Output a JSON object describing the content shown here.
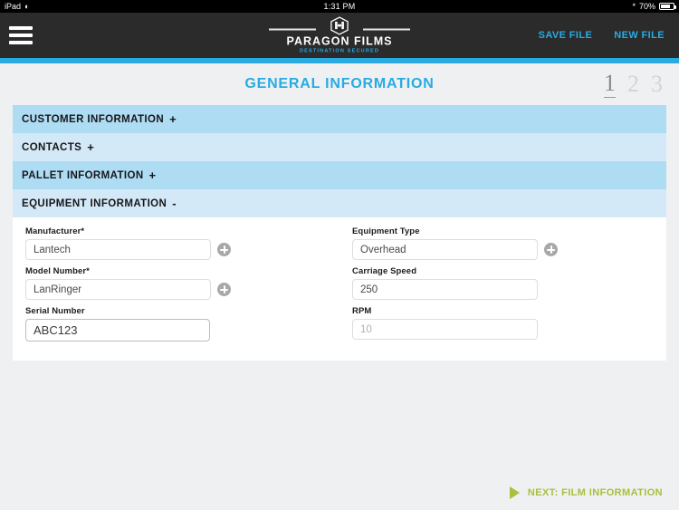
{
  "status_bar": {
    "device": "iPad",
    "wifi_icon": "wifi-icon",
    "time": "1:31 PM",
    "bluetooth_icon": "bluetooth-icon",
    "battery_percent": "70%"
  },
  "header": {
    "menu_icon": "hamburger-menu-icon",
    "brand_name": "PARAGON FILMS",
    "brand_tagline": "DESTINATION SECURED",
    "brand_emblem_icon": "paragon-shield-icon",
    "save_file_label": "SAVE FILE",
    "new_file_label": "NEW FILE",
    "link_color": "#29abe2",
    "bar_color": "#2b2b2b",
    "accent_bar_color": "#29abe2"
  },
  "page": {
    "title": "GENERAL INFORMATION",
    "title_color": "#29abe2",
    "steps": [
      {
        "label": "1",
        "active": true
      },
      {
        "label": "2",
        "active": false
      },
      {
        "label": "3",
        "active": false
      }
    ]
  },
  "sections": [
    {
      "title": "CUSTOMER INFORMATION",
      "sign": "+",
      "expanded": false,
      "shade": "dark"
    },
    {
      "title": "CONTACTS",
      "sign": "+",
      "expanded": false,
      "shade": "light"
    },
    {
      "title": "PALLET INFORMATION",
      "sign": "+",
      "expanded": false,
      "shade": "dark"
    },
    {
      "title": "EQUIPMENT INFORMATION",
      "sign": "-",
      "expanded": true,
      "shade": "light"
    }
  ],
  "equipment_form": {
    "left": [
      {
        "label": "Manufacturer*",
        "value": "Lantech",
        "placeholder": "",
        "has_add": true,
        "state": "filled"
      },
      {
        "label": "Model Number*",
        "value": "LanRinger",
        "placeholder": "",
        "has_add": true,
        "state": "filled"
      },
      {
        "label": "Serial Number",
        "value": "ABC123",
        "placeholder": "",
        "has_add": false,
        "state": "focused"
      }
    ],
    "right": [
      {
        "label": "Equipment Type",
        "value": "Overhead",
        "placeholder": "",
        "has_add": true,
        "state": "filled"
      },
      {
        "label": "Carriage Speed",
        "value": "250",
        "placeholder": "",
        "has_add": false,
        "state": "filled"
      },
      {
        "label": "RPM",
        "value": "",
        "placeholder": "10",
        "has_add": false,
        "state": "placeholder"
      }
    ],
    "add_button_icon": "plus-circle-icon"
  },
  "footer": {
    "next_icon": "play-triangle-icon",
    "next_label": "NEXT: FILM INFORMATION",
    "next_color": "#a8c03c"
  }
}
